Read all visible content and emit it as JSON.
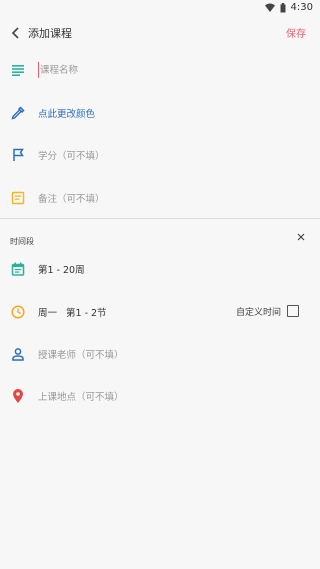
{
  "status": {
    "time": "4:30"
  },
  "header": {
    "title": "添加课程",
    "save_label": "保存"
  },
  "form": {
    "course_name_placeholder": "课程名称",
    "color_label": "点此更改颜色",
    "credit_placeholder": "学分（可不填）",
    "note_placeholder": "备注（可不填）"
  },
  "time_section": {
    "label": "时间段",
    "weeks": "第1 - 20周",
    "day": "周一",
    "sections": "第1 - 2节",
    "custom_time_label": "自定义时间",
    "teacher_placeholder": "授课老师（可不填）",
    "location_placeholder": "上课地点（可不填）"
  },
  "colors": {
    "accent": "#e8606f",
    "teal": "#2bb3a0",
    "blue": "#2a6fb8",
    "yellow": "#f2b824",
    "orange": "#f5a623",
    "red": "#e04848"
  }
}
